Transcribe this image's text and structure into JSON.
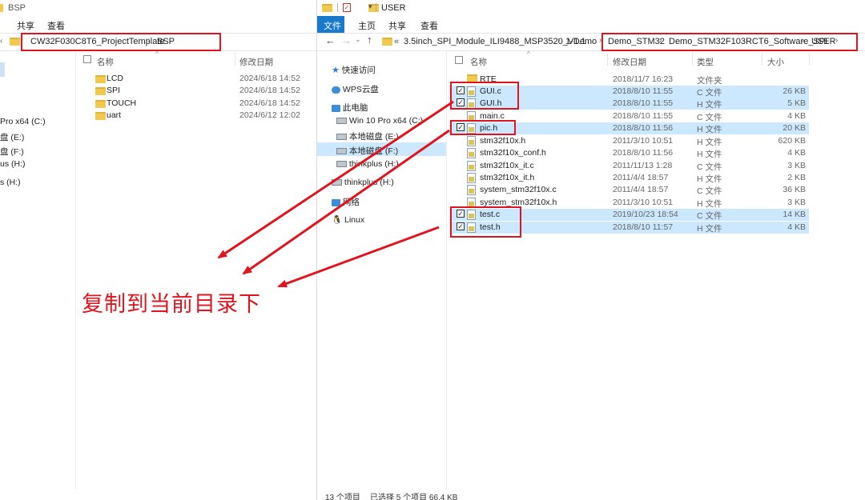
{
  "left_window": {
    "title": "BSP",
    "ribbon_tabs": [
      "共享",
      "查看"
    ],
    "breadcrumb": [
      "CW32F030C8T6_ProjectTemplate",
      "BSP"
    ],
    "columns": {
      "name": "名称",
      "modified": "修改日期"
    },
    "nav_items": [
      "Pro x64 (C:)",
      "盘 (E:)",
      "盘 (F:)",
      "us (H:)",
      "s (H:)"
    ],
    "files": [
      {
        "name": "LCD",
        "modified": "2024/6/18 14:52"
      },
      {
        "name": "SPI",
        "modified": "2024/6/18 14:52"
      },
      {
        "name": "TOUCH",
        "modified": "2024/6/18 14:52"
      },
      {
        "name": "uart",
        "modified": "2024/6/12 12:02"
      }
    ]
  },
  "right_window": {
    "title": "USER",
    "ribbon_tabs": [
      "文件",
      "主页",
      "共享",
      "查看"
    ],
    "breadcrumb": [
      "«",
      "3.5inch_SPI_Module_ILI9488_MSP3520_V1.1",
      "1-Demo",
      "Demo_STM32",
      "Demo_STM32F103RCT6_Software_SPI",
      "USER"
    ],
    "columns": {
      "name": "名称",
      "modified": "修改日期",
      "type": "类型",
      "size": "大小"
    },
    "nav": [
      {
        "label": "快速访问",
        "icon": "star-icon"
      },
      {
        "label": "WPS云盘",
        "icon": "cloud-icon"
      },
      {
        "label": "此电脑",
        "icon": "computer-icon"
      },
      {
        "label": "Win 10 Pro x64 (C:)",
        "icon": "drive-icon"
      },
      {
        "label": "本地磁盘 (E:)",
        "icon": "drive-icon"
      },
      {
        "label": "本地磁盘 (F:)",
        "icon": "drive-icon"
      },
      {
        "label": "thinkplus (H:)",
        "icon": "drive-icon"
      },
      {
        "label": "thinkplus (H:)",
        "icon": "drive-icon"
      },
      {
        "label": "网络",
        "icon": "network-icon"
      },
      {
        "label": "Linux",
        "icon": "linux-icon"
      }
    ],
    "files": [
      {
        "name": "RTE",
        "modified": "2018/11/7 16:23",
        "type": "文件夹",
        "size": "",
        "selected": false,
        "checked": false,
        "folder": true
      },
      {
        "name": "GUI.c",
        "modified": "2018/8/10 11:55",
        "type": "C 文件",
        "size": "26 KB",
        "selected": true,
        "checked": true
      },
      {
        "name": "GUI.h",
        "modified": "2018/8/10 11:55",
        "type": "H 文件",
        "size": "5 KB",
        "selected": true,
        "checked": true
      },
      {
        "name": "main.c",
        "modified": "2018/8/10 11:55",
        "type": "C 文件",
        "size": "4 KB",
        "selected": false,
        "checked": false
      },
      {
        "name": "pic.h",
        "modified": "2018/8/10 11:56",
        "type": "H 文件",
        "size": "20 KB",
        "selected": true,
        "checked": true
      },
      {
        "name": "stm32f10x.h",
        "modified": "2011/3/10 10:51",
        "type": "H 文件",
        "size": "620 KB",
        "selected": false,
        "checked": false
      },
      {
        "name": "stm32f10x_conf.h",
        "modified": "2018/8/10 11:56",
        "type": "H 文件",
        "size": "4 KB",
        "selected": false,
        "checked": false
      },
      {
        "name": "stm32f10x_it.c",
        "modified": "2011/11/13 1:28",
        "type": "C 文件",
        "size": "3 KB",
        "selected": false,
        "checked": false
      },
      {
        "name": "stm32f10x_it.h",
        "modified": "2011/4/4 18:57",
        "type": "H 文件",
        "size": "2 KB",
        "selected": false,
        "checked": false
      },
      {
        "name": "system_stm32f10x.c",
        "modified": "2011/4/4 18:57",
        "type": "C 文件",
        "size": "36 KB",
        "selected": false,
        "checked": false
      },
      {
        "name": "system_stm32f10x.h",
        "modified": "2011/3/10 10:51",
        "type": "H 文件",
        "size": "3 KB",
        "selected": false,
        "checked": false
      },
      {
        "name": "test.c",
        "modified": "2019/10/23 18:54",
        "type": "C 文件",
        "size": "14 KB",
        "selected": true,
        "checked": true
      },
      {
        "name": "test.h",
        "modified": "2018/8/10 11:57",
        "type": "H 文件",
        "size": "4 KB",
        "selected": true,
        "checked": true
      }
    ],
    "status": {
      "count": "13 个项目",
      "selection": "已选择 5 个项目 66.4 KB"
    }
  },
  "annotation": "复制到当前目录下",
  "colors": {
    "annotation_red": "#e0141e",
    "selection_blue": "#cce8ff",
    "ribbon_file_tab": "#1979ca"
  }
}
